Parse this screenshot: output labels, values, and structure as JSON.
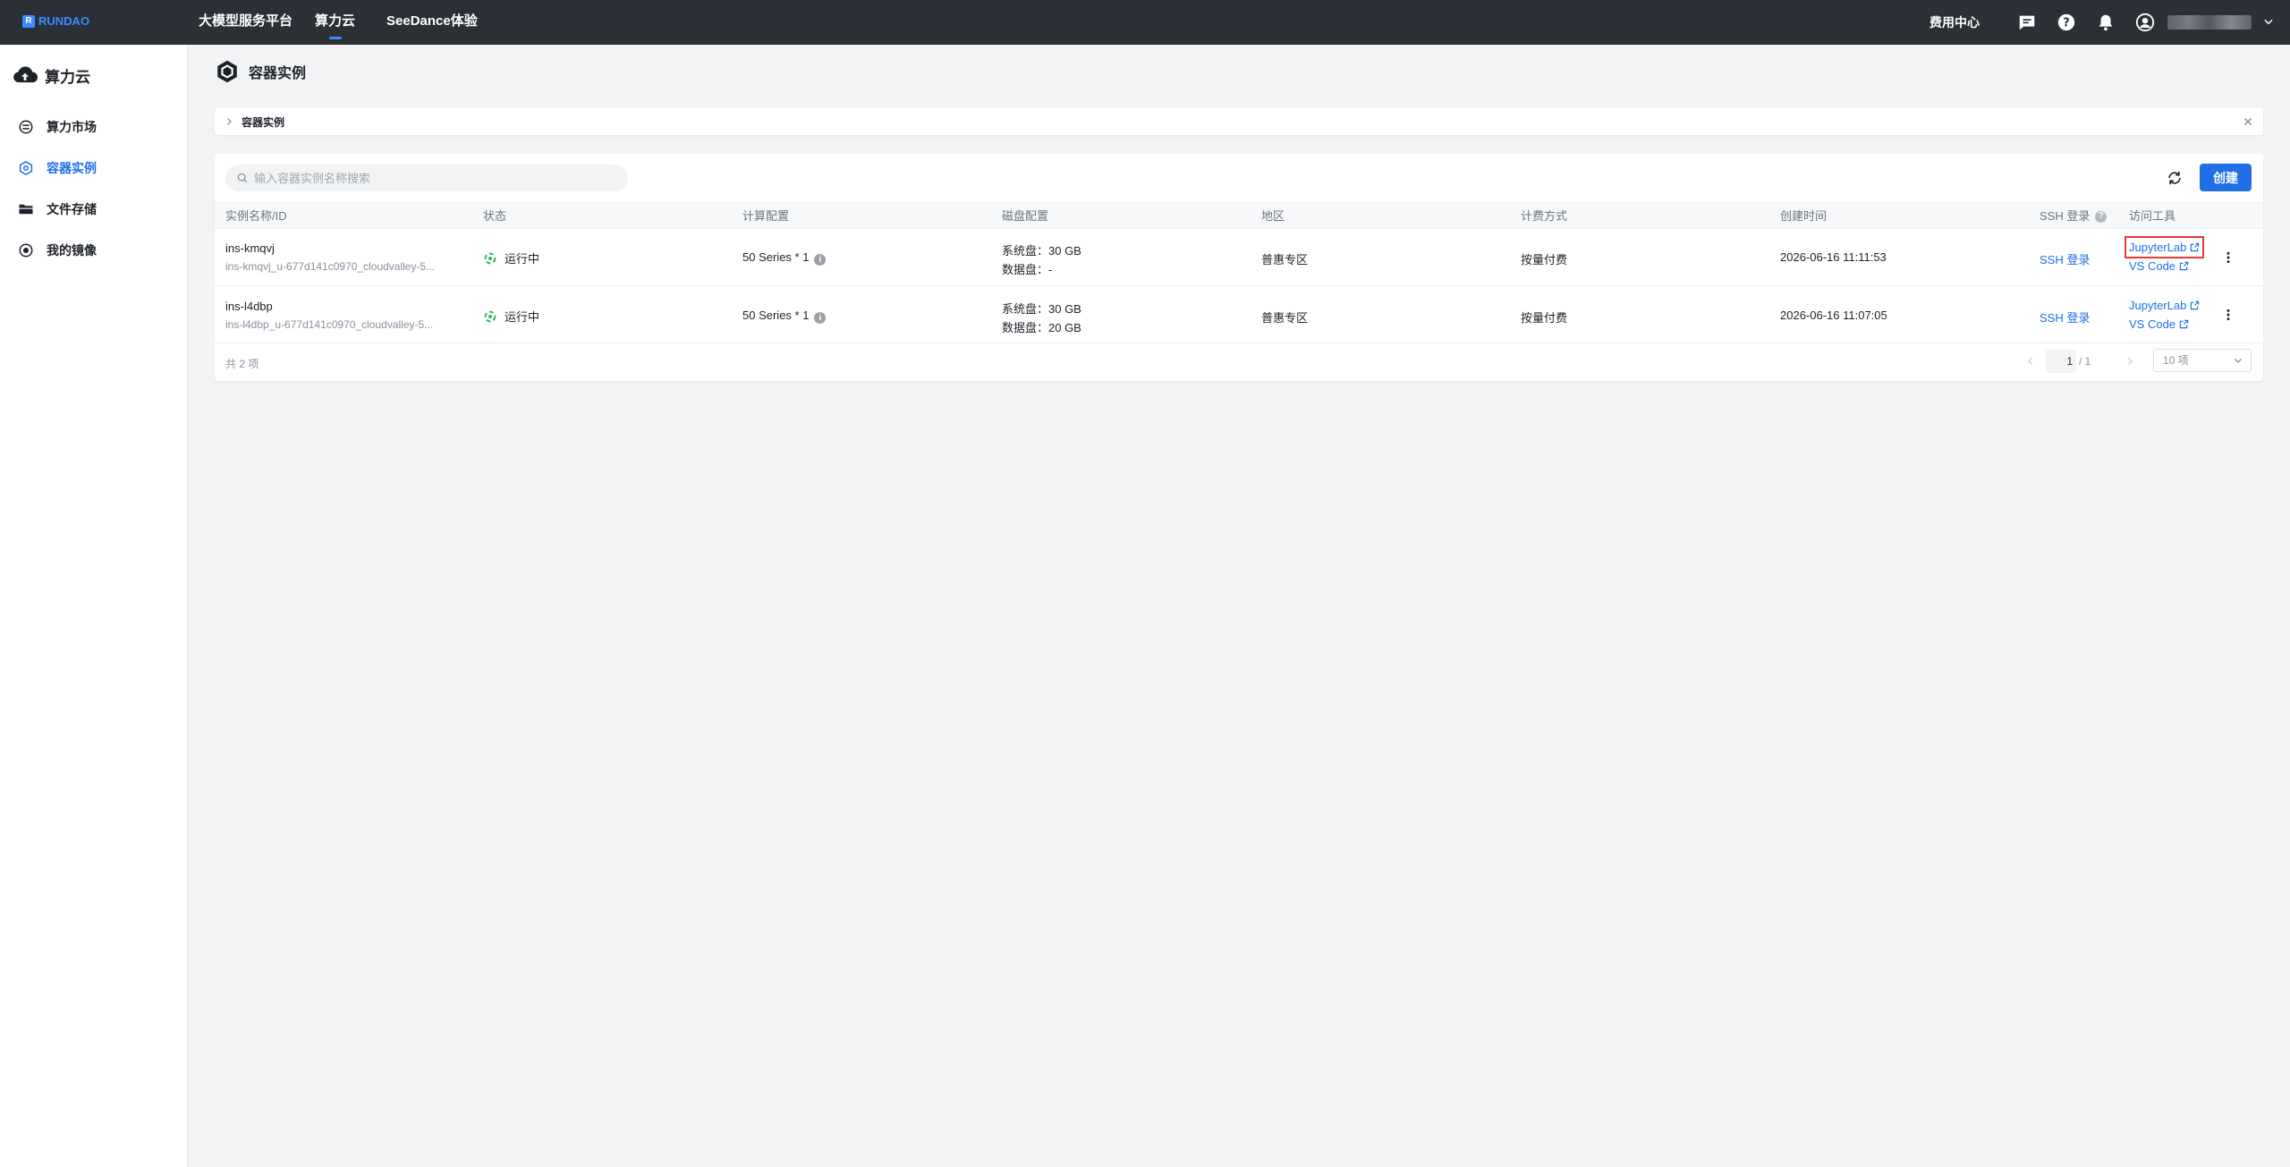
{
  "topbar": {
    "logo": "RUNDAO",
    "nav": [
      {
        "label": "大模型服务平台"
      },
      {
        "label": "算力云"
      },
      {
        "label": "SeeDance体验"
      }
    ],
    "fee_center": "费用中心"
  },
  "sidebar": {
    "title": "算力云",
    "items": [
      {
        "label": "算力市场"
      },
      {
        "label": "容器实例"
      },
      {
        "label": "文件存储"
      },
      {
        "label": "我的镜像"
      }
    ]
  },
  "page": {
    "title": "容器实例",
    "breadcrumb": "容器实例"
  },
  "toolbar": {
    "search_placeholder": "输入容器实例名称搜索",
    "create_label": "创建"
  },
  "table": {
    "columns": [
      "实例名称/ID",
      "状态",
      "计算配置",
      "磁盘配置",
      "地区",
      "计费方式",
      "创建时间",
      "SSH 登录",
      "访问工具"
    ],
    "rows": [
      {
        "name": "ins-kmqvj",
        "id": "ins-kmqvj_u-677d141c0970_cloudvalley-5...",
        "status": "运行中",
        "compute": "50 Series * 1",
        "system_disk": "系统盘：30 GB",
        "data_disk": "数据盘：-",
        "region": "普惠专区",
        "billing": "按量付费",
        "created": "2026-06-16 11:11:53",
        "ssh": "SSH 登录",
        "tool1": "JupyterLab",
        "tool2": "VS Code"
      },
      {
        "name": "ins-l4dbp",
        "id": "ins-l4dbp_u-677d141c0970_cloudvalley-5...",
        "status": "运行中",
        "compute": "50 Series * 1",
        "system_disk": "系统盘：30 GB",
        "data_disk": "数据盘：20 GB",
        "region": "普惠专区",
        "billing": "按量付费",
        "created": "2026-06-16 11:07:05",
        "ssh": "SSH 登录",
        "tool1": "JupyterLab",
        "tool2": "VS Code"
      }
    ]
  },
  "footer": {
    "total": "共 2 项",
    "page_current": "1",
    "page_total": "/ 1",
    "page_size": "10 项"
  },
  "colors": {
    "accent": "#1f6fe5",
    "topbar_bg": "#2b2f36",
    "status_running": "#2fb35c",
    "highlight": "#e53935"
  }
}
